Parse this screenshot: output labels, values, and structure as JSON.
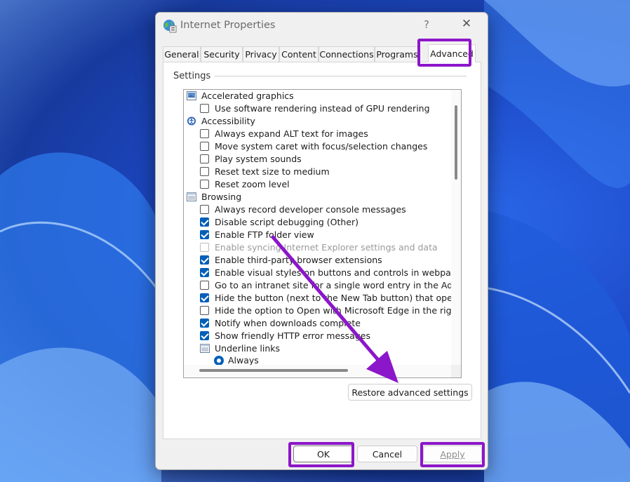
{
  "window": {
    "title": "Internet Properties",
    "help_label": "?",
    "close_label": "✕"
  },
  "tabs": [
    {
      "label": "General"
    },
    {
      "label": "Security"
    },
    {
      "label": "Privacy"
    },
    {
      "label": "Content"
    },
    {
      "label": "Connections"
    },
    {
      "label": "Programs"
    },
    {
      "label": "Advanced",
      "active": true
    }
  ],
  "settings": {
    "group_title": "Settings",
    "categories": [
      {
        "icon": "display-icon",
        "label": "Accelerated graphics",
        "options": [
          {
            "label": "Use software rendering instead of GPU rendering",
            "checked": false
          }
        ]
      },
      {
        "icon": "accessibility-icon",
        "label": "Accessibility",
        "options": [
          {
            "label": "Always expand ALT text for images",
            "checked": false
          },
          {
            "label": "Move system caret with focus/selection changes",
            "checked": false
          },
          {
            "label": "Play system sounds",
            "checked": false
          },
          {
            "label": "Reset text size to medium",
            "checked": false
          },
          {
            "label": "Reset zoom level",
            "checked": false
          }
        ]
      },
      {
        "icon": "document-icon",
        "label": "Browsing",
        "options": [
          {
            "label": "Always record developer console messages",
            "checked": false
          },
          {
            "label": "Disable script debugging (Other)",
            "checked": true
          },
          {
            "label": "Enable FTP folder view",
            "checked": true
          },
          {
            "label": "Enable syncing Internet Explorer settings and data",
            "checked": false,
            "disabled": true
          },
          {
            "label": "Enable third-party browser extensions",
            "checked": true
          },
          {
            "label": "Enable visual styles on buttons and controls in webpages",
            "checked": true
          },
          {
            "label": "Go to an intranet site for a single word entry in the Addre",
            "checked": false
          },
          {
            "label": "Hide the button (next to the New Tab button) that opens M",
            "checked": true
          },
          {
            "label": "Hide the option to Open with Microsoft Edge in the right-c",
            "checked": false
          },
          {
            "label": "Notify when downloads complete",
            "checked": true
          },
          {
            "label": "Show friendly HTTP error messages",
            "checked": true
          }
        ]
      }
    ],
    "subgroup": {
      "icon": "document-icon",
      "label": "Underline links",
      "radio_label": "Always",
      "radio_selected": true
    }
  },
  "buttons": {
    "restore": "Restore advanced settings",
    "ok": "OK",
    "cancel": "Cancel",
    "apply": "Apply"
  },
  "colors": {
    "highlight": "#8c16c9",
    "check_accent": "#005fb8"
  }
}
